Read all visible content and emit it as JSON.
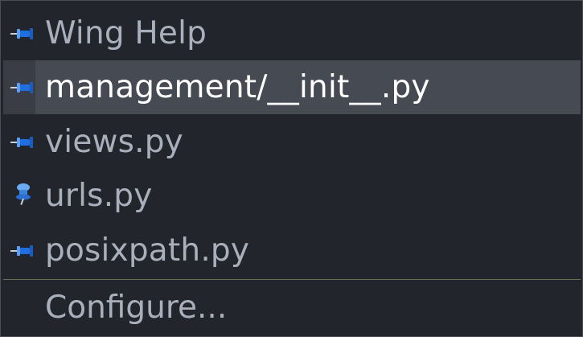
{
  "menu": {
    "items": [
      {
        "label": "Wing Help",
        "icon": "pin-icon",
        "selected": false
      },
      {
        "label": "management/__init__.py",
        "icon": "pin-icon",
        "selected": true
      },
      {
        "label": "views.py",
        "icon": "pin-icon",
        "selected": false
      },
      {
        "label": "urls.py",
        "icon": "pushpin-upright-icon",
        "selected": false
      },
      {
        "label": "posixpath.py",
        "icon": "pin-icon",
        "selected": false
      }
    ],
    "configure_label": "Configure..."
  },
  "colors": {
    "background": "#22252b",
    "selected_background": "#464a53",
    "text": "#a9b0bc",
    "selected_text": "#ffffff",
    "pin_blue": "#1f6fe0",
    "separator": "#6c6d55"
  }
}
